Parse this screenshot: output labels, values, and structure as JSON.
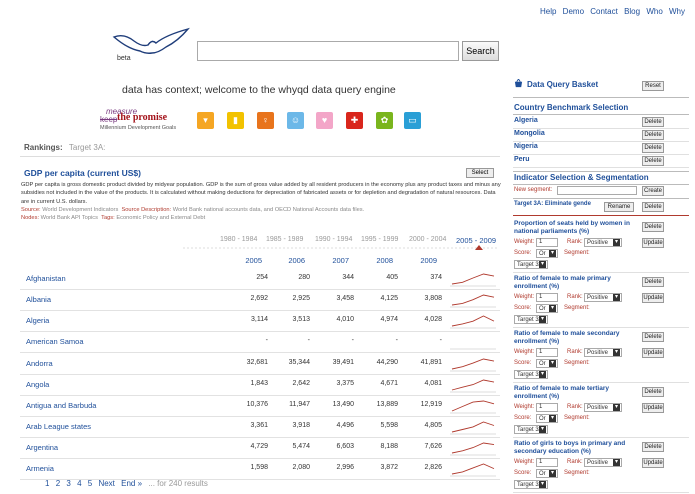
{
  "topnav": [
    "Help",
    "Demo",
    "Contact",
    "Blog",
    "Who",
    "Why"
  ],
  "logo": {
    "badge": "beta"
  },
  "search": {
    "value": "",
    "button": "Search"
  },
  "tagline": "data has context; welcome to the whyqd data query engine",
  "mdg": {
    "measure": "measure",
    "keep": "keep",
    "title": "the promise",
    "subtitle": "Millennium Development Goals"
  },
  "goal_icons": [
    {
      "icon": "poverty-icon",
      "color": "#f5a623",
      "glyph": "▾"
    },
    {
      "icon": "education-icon",
      "color": "#f2c200",
      "glyph": "▮"
    },
    {
      "icon": "gender-icon",
      "color": "#e8741c",
      "glyph": "♀"
    },
    {
      "icon": "child-health-icon",
      "color": "#6cb8e8",
      "glyph": "☺"
    },
    {
      "icon": "maternal-health-icon",
      "color": "#f3a6c8",
      "glyph": "♥"
    },
    {
      "icon": "disease-icon",
      "color": "#d9261c",
      "glyph": "✚"
    },
    {
      "icon": "environment-icon",
      "color": "#7ab51d",
      "glyph": "✿"
    },
    {
      "icon": "partnership-icon",
      "color": "#2a9fd6",
      "glyph": "▭"
    }
  ],
  "rankings": {
    "label": "Rankings:",
    "target": "Target 3A:"
  },
  "indicator": {
    "title": "GDP per capita (current US$)",
    "select": "Select",
    "description": "GDP per capita is gross domestic product divided by midyear population. GDP is the sum of gross value added by all resident producers in the economy plus any product taxes and minus any subsidies not included in the value of the products. It is calculated without making deductions for depreciation of fabricated assets or for depletion and degradation of natural resources. Data are in current U.S. dollars.",
    "source_label": "Source:",
    "source": "World Development Indicators",
    "source_desc_label": "Source Description:",
    "source_desc": "World Bank national accounts data, and OECD National Accounts data files.",
    "nodes_label": "Nodes:",
    "nodes": "World Bank API Topics",
    "tags_label": "Tags:",
    "tags": "Economic Policy and External Debt"
  },
  "periods": [
    "1980 - 1984",
    "1985 - 1989",
    "1990 - 1994",
    "1995 - 1999",
    "2000 - 2004",
    "2005 - 2009"
  ],
  "active_period": "2005 - 2009",
  "years": [
    "2005",
    "2006",
    "2007",
    "2008",
    "2009"
  ],
  "rows": [
    {
      "country": "Afghanistan",
      "values": [
        "254",
        "280",
        "344",
        "405",
        "374"
      ]
    },
    {
      "country": "Albania",
      "values": [
        "2,692",
        "2,925",
        "3,458",
        "4,125",
        "3,808"
      ]
    },
    {
      "country": "Algeria",
      "values": [
        "3,114",
        "3,513",
        "4,010",
        "4,974",
        "4,028"
      ]
    },
    {
      "country": "American Samoa",
      "values": [
        "-",
        "-",
        "-",
        "-",
        "-"
      ]
    },
    {
      "country": "Andorra",
      "values": [
        "32,681",
        "35,344",
        "39,491",
        "44,290",
        "41,891"
      ]
    },
    {
      "country": "Angola",
      "values": [
        "1,843",
        "2,642",
        "3,375",
        "4,671",
        "4,081"
      ]
    },
    {
      "country": "Antigua and Barbuda",
      "values": [
        "10,376",
        "11,947",
        "13,490",
        "13,889",
        "12,919"
      ]
    },
    {
      "country": "Arab League states",
      "values": [
        "3,361",
        "3,918",
        "4,496",
        "5,598",
        "4,805"
      ]
    },
    {
      "country": "Argentina",
      "values": [
        "4,729",
        "5,474",
        "6,603",
        "8,188",
        "7,626"
      ]
    },
    {
      "country": "Armenia",
      "values": [
        "1,598",
        "2,080",
        "2,996",
        "3,872",
        "2,826"
      ]
    }
  ],
  "pager": {
    "pages": [
      "1",
      "2",
      "3",
      "4",
      "5"
    ],
    "next": "Next",
    "end": "End »",
    "summary": "... for 240 results"
  },
  "basket": {
    "title": "Data Query Basket",
    "reset": "Reset",
    "country_heading": "Country Benchmark Selection",
    "countries": [
      "Algeria",
      "Mongolia",
      "Nigeria",
      "Peru"
    ],
    "delete": "Delete",
    "indicator_heading": "Indicator Selection & Segmentation",
    "new_segment_label": "New segment:",
    "create": "Create",
    "segment_name": "Target 3A: Eliminate gende",
    "rename": "Rename",
    "weight_label": "Weight:",
    "rank_label": "Rank:",
    "score_label": "Score:",
    "segment_label": "Segment:",
    "update": "Update",
    "weight_value": "1",
    "rank_value": "Positive",
    "score_value": "Or",
    "segment_value": "Target 3A:",
    "indicators": [
      "Proportion of seats held by women in national parliaments (%)",
      "Ratio of female to male primary enrollment (%)",
      "Ratio of female to male secondary enrollment (%)",
      "Ratio of female to male tertiary enrollment (%)",
      "Ratio of girls to boys in primary and secondary education (%)"
    ]
  },
  "colors": {
    "link": "#1f4f9a",
    "accent_red": "#b03a2e",
    "spark": "#b03a2e"
  }
}
